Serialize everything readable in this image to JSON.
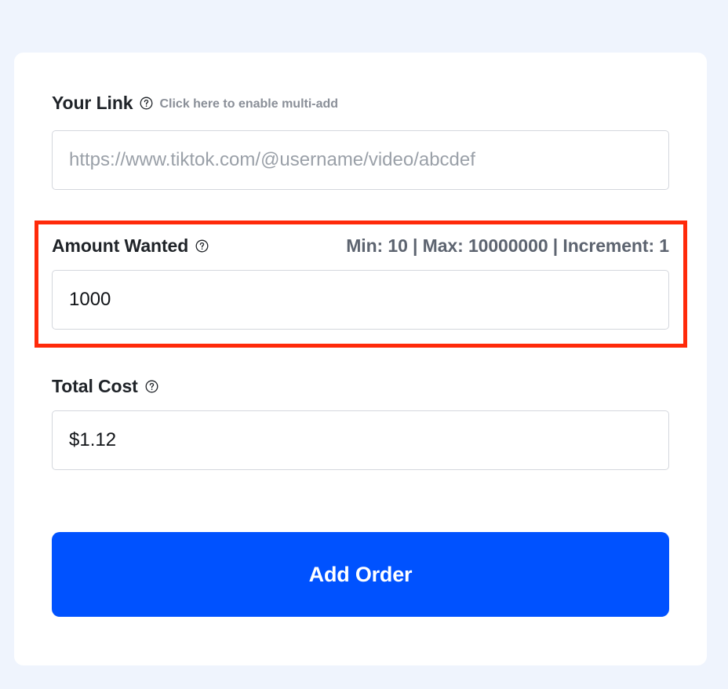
{
  "form": {
    "link": {
      "label": "Your Link",
      "help_icon": "question-circle-icon",
      "hint": "Click here to enable multi-add",
      "placeholder": "https://www.tiktok.com/@username/video/abcdef",
      "value": ""
    },
    "amount": {
      "label": "Amount Wanted",
      "help_icon": "question-circle-icon",
      "limits": "Min: 10 | Max: 10000000 | Increment: 1",
      "value": "1000"
    },
    "total": {
      "label": "Total Cost",
      "help_icon": "question-circle-icon",
      "value": "$1.12"
    },
    "submit_label": "Add Order"
  },
  "colors": {
    "page_background": "#eff4fd",
    "card_background": "#ffffff",
    "primary_button": "#0052ff",
    "highlight_border": "#ff2a0a",
    "hint_text": "#8a8f98"
  }
}
